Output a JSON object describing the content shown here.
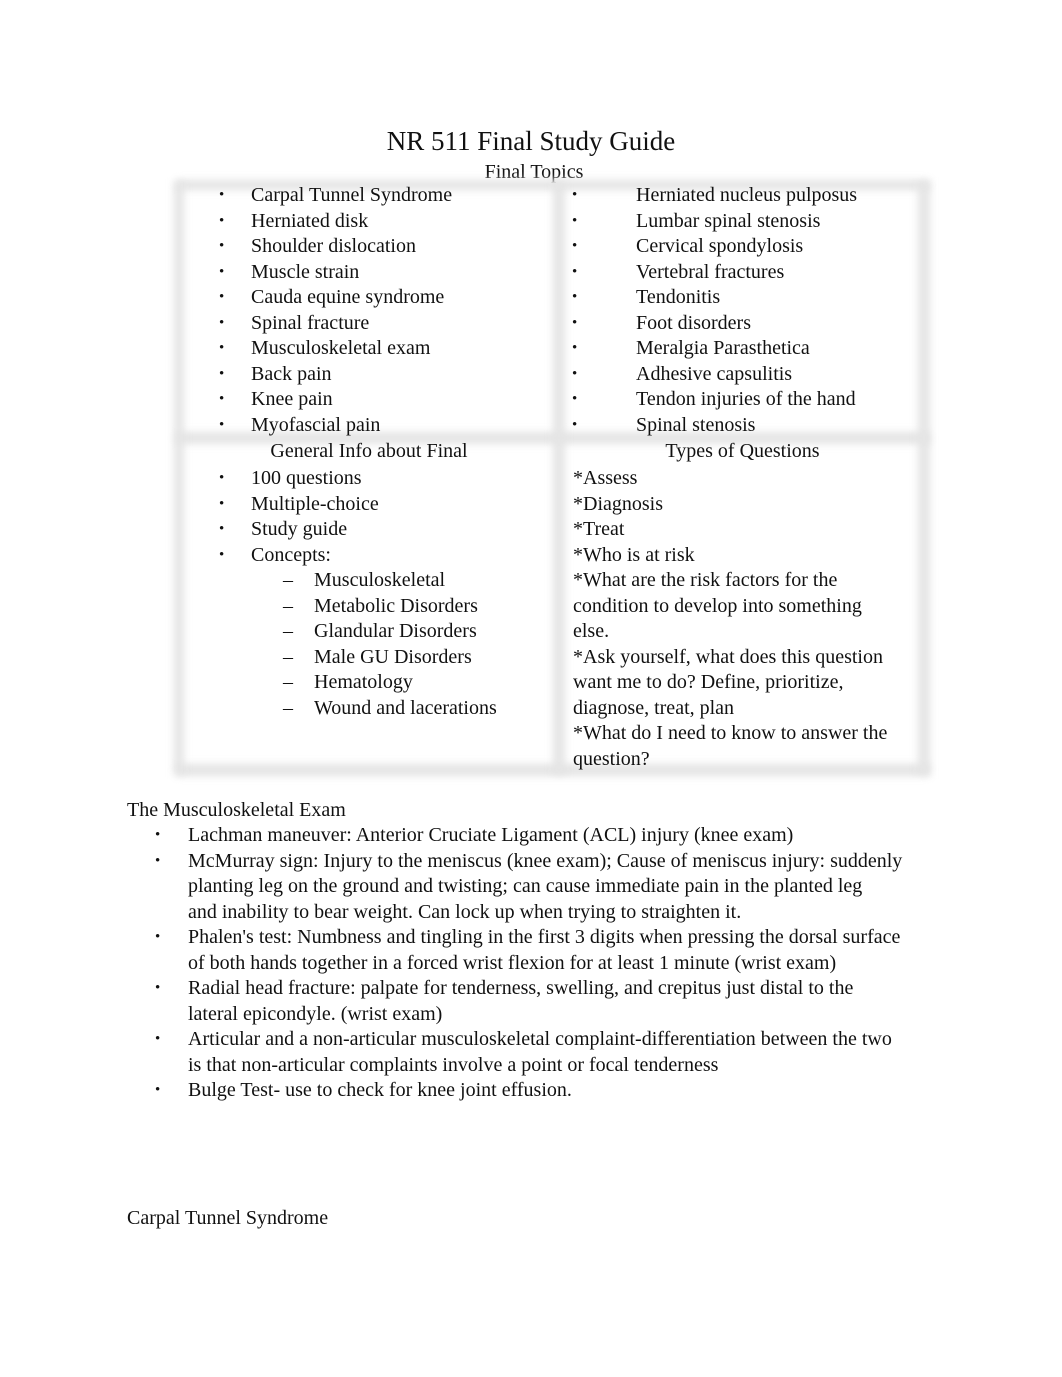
{
  "document": {
    "title": "NR 511 Final Study Guide",
    "subtitle": "Final Topics"
  },
  "table": {
    "topics_left": [
      "Carpal Tunnel Syndrome",
      "Herniated disk",
      "Shoulder dislocation",
      "Muscle strain",
      "Cauda equine syndrome",
      "Spinal fracture",
      "Musculoskeletal exam",
      "Back pain",
      "Knee pain",
      "Myofascial pain"
    ],
    "topics_right": [
      "Herniated nucleus pulposus",
      "Lumbar spinal stenosis",
      "Cervical spondylosis",
      "Vertebral fractures",
      "Tendonitis",
      "Foot disorders",
      "Meralgia Parasthetica",
      "Adhesive capsulitis",
      "Tendon injuries of the hand",
      "Spinal stenosis"
    ],
    "general_info": {
      "heading": "General Info about Final",
      "items": [
        "100 questions",
        "Multiple-choice",
        "Study guide",
        "Concepts:"
      ],
      "concepts": [
        "Musculoskeletal",
        "Metabolic Disorders",
        "Glandular Disorders",
        "Male GU Disorders",
        "Hematology",
        "Wound and lacerations"
      ]
    },
    "question_types": {
      "heading": "Types of Questions",
      "lines": [
        "*Assess",
        "*Diagnosis",
        "*Treat",
        "*Who is at risk",
        "*What are the risk factors for the",
        "condition to develop into something",
        "else.",
        "*Ask yourself, what does this question",
        "want me to do? Define, prioritize,",
        "diagnose, treat, plan",
        "*What do I need to know to answer the",
        "question?"
      ]
    }
  },
  "bullet_glyph": "•",
  "dash_glyph": "–",
  "msk_exam": {
    "heading": "The Musculoskeletal Exam",
    "items": [
      [
        "Lachman maneuver: Anterior Cruciate Ligament (ACL) injury (knee exam)"
      ],
      [
        "McMurray sign: Injury to the meniscus (knee exam); Cause of meniscus injury: suddenly",
        "planting leg on the ground and twisting; can cause immediate pain in the planted leg",
        "and inability to bear weight. Can lock up when trying to straighten it."
      ],
      [
        "Phalen's test: Numbness and tingling in the first 3 digits when pressing the dorsal surface",
        "of both hands together in a forced wrist flexion for at least 1 minute (wrist exam)"
      ],
      [
        "Radial head fracture: palpate for tenderness, swelling, and crepitus just distal to the",
        "lateral epicondyle. (wrist exam)"
      ],
      [
        "Articular and a non-articular musculoskeletal complaint-differentiation between the two",
        "is that non-articular complaints involve a point or focal tenderness"
      ],
      [
        "Bulge Test- use to check for knee joint effusion."
      ]
    ]
  },
  "next_section": {
    "heading": "Carpal Tunnel Syndrome"
  }
}
